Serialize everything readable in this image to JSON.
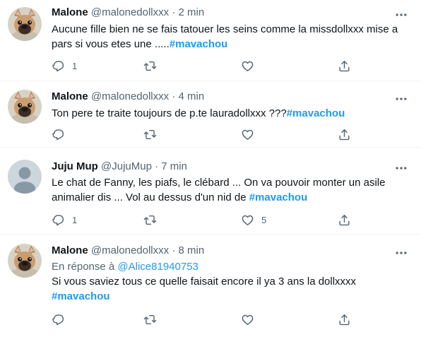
{
  "tweets": [
    {
      "name": "Malone",
      "handle": "@malonedollxxx",
      "time": "2 min",
      "reply_prefix": "",
      "reply_to": "",
      "text": "Aucune fille bien ne se fais tatouer les seins comme la missdollxxx mise a pars si vous etes une .....",
      "hashtag": "#mavachou",
      "replies": "1",
      "retweets": "",
      "likes": "",
      "avatar": "french-bulldog"
    },
    {
      "name": "Malone",
      "handle": "@malonedollxxx",
      "time": "4 min",
      "reply_prefix": "",
      "reply_to": "",
      "text": "Ton pere te traite toujours de p.te lauradollxxx ???",
      "hashtag": "#mavachou",
      "replies": "",
      "retweets": "",
      "likes": "",
      "avatar": "french-bulldog"
    },
    {
      "name": "Juju Mup",
      "handle": "@JujuMup",
      "time": "7 min",
      "reply_prefix": "",
      "reply_to": "",
      "text": "Le chat de Fanny, les piafs, le clébard ... On va pouvoir monter un asile animalier dis ... Vol au dessus d'un nid de ",
      "hashtag": "#mavachou",
      "replies": "1",
      "retweets": "",
      "likes": "5",
      "avatar": "default-user"
    },
    {
      "name": "Malone",
      "handle": "@malonedollxxx",
      "time": "8 min",
      "reply_prefix": "En réponse à ",
      "reply_to": "@Alice81940753",
      "text": "Si vous saviez tous ce quelle faisait encore il ya 3 ans la dollxxxx",
      "hashtag": "#mavachou",
      "replies": "",
      "retweets": "",
      "likes": "",
      "avatar": "french-bulldog"
    }
  ],
  "separator": "·",
  "icons": {
    "more": "more-icon",
    "reply": "reply-icon",
    "retweet": "retweet-icon",
    "like": "heart-icon",
    "share": "share-icon"
  },
  "colors": {
    "hashtag": "#1d9bf0",
    "secondary_text": "#536471",
    "divider": "#eff3f4"
  }
}
